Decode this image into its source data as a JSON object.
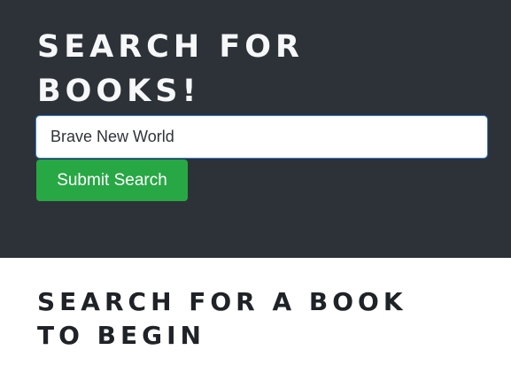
{
  "hero": {
    "title": "SEARCH FOR\nBOOKS!",
    "background_color": "#2d3238"
  },
  "search": {
    "value": "Brave New World",
    "placeholder": ""
  },
  "submit": {
    "label": "Submit Search",
    "color": "#28a745"
  },
  "results": {
    "empty_message": "SEARCH FOR A BOOK\nTO BEGIN"
  }
}
